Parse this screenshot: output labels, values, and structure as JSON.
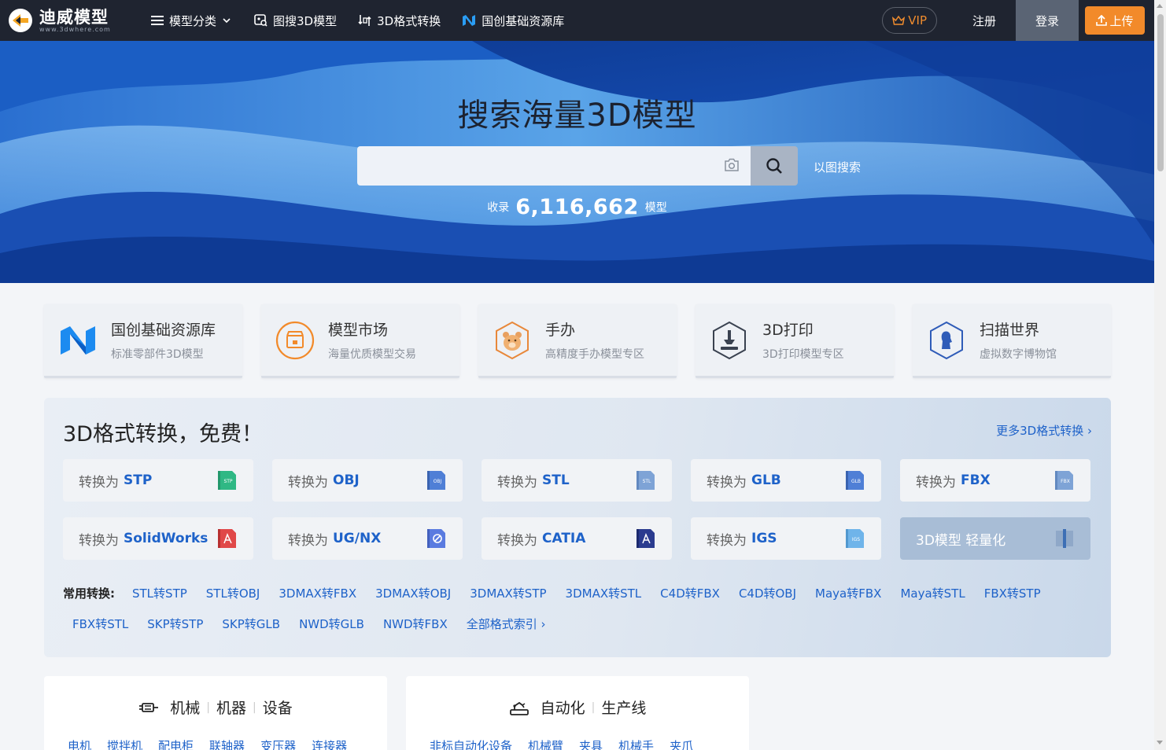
{
  "nav": {
    "logo_cn": "迪威模型",
    "logo_en": "www.3dwhere.com",
    "items": [
      {
        "label": "模型分类",
        "icon": "menu-icon"
      },
      {
        "label": "图搜3D模型",
        "icon": "image-search-icon"
      },
      {
        "label": "3D格式转换",
        "icon": "convert-icon"
      },
      {
        "label": "国创基础资源库",
        "icon": "n-logo-icon"
      }
    ],
    "vip": "VIP",
    "register": "注册",
    "login": "登录",
    "upload": "上传"
  },
  "hero": {
    "title": "搜索海量3D模型",
    "search_placeholder": "",
    "image_search": "以图搜索",
    "stats_prefix": "收录",
    "stats_count": "6,116,662",
    "stats_suffix": "模型"
  },
  "cards": [
    {
      "title": "国创基础资源库",
      "sub": "标准零部件3D模型",
      "icon": "n-logo-icon"
    },
    {
      "title": "模型市场",
      "sub": "海量优质模型交易",
      "icon": "shop-icon"
    },
    {
      "title": "手办",
      "sub": "高精度手办模型专区",
      "icon": "bear-icon"
    },
    {
      "title": "3D打印",
      "sub": "3D打印模型专区",
      "icon": "printer-icon"
    },
    {
      "title": "扫描世界",
      "sub": "虚拟数字博物馆",
      "icon": "statue-icon"
    }
  ],
  "converter": {
    "title": "3D格式转换，免费！",
    "more": "更多3D格式转换 ›",
    "prefix": "转换为",
    "row1": [
      {
        "fmt": "STP",
        "tag": "STP",
        "color": "#2fb884"
      },
      {
        "fmt": "OBJ",
        "tag": "OBJ",
        "color": "#4f7fd6"
      },
      {
        "fmt": "STL",
        "tag": "STL",
        "color": "#7ea3d6"
      },
      {
        "fmt": "GLB",
        "tag": "GLB",
        "color": "#4f7fd6"
      },
      {
        "fmt": "FBX",
        "tag": "FBX",
        "color": "#7ea3d6"
      }
    ],
    "row2": [
      {
        "fmt": "SolidWorks",
        "tag": "SW",
        "color": "#e04848"
      },
      {
        "fmt": "UG/NX",
        "tag": "NX",
        "color": "#5a7be0"
      },
      {
        "fmt": "CATIA",
        "tag": "CA",
        "color": "#2a3b8f"
      },
      {
        "fmt": "IGS",
        "tag": "IGS",
        "color": "#6fb4ea"
      }
    ],
    "lightweight": "3D模型 轻量化",
    "common_label": "常用转换:",
    "common_row1": [
      "STL转STP",
      "STL转OBJ",
      "3DMAX转FBX",
      "3DMAX转OBJ",
      "3DMAX转STP",
      "3DMAX转STL",
      "C4D转FBX",
      "C4D转OBJ",
      "Maya转FBX",
      "Maya转STL",
      "FBX转STP"
    ],
    "common_row2": [
      "FBX转STL",
      "SKP转STP",
      "SKP转GLB",
      "NWD转GLB",
      "NWD转FBX",
      "全部格式索引 ›"
    ]
  },
  "boxes": [
    {
      "head": [
        "机械",
        "机器",
        "设备"
      ],
      "icon": "machine-icon",
      "links": [
        "电机",
        "搅拌机",
        "配电柜",
        "联轴器",
        "变压器",
        "连接器"
      ]
    },
    {
      "head": [
        "自动化",
        "生产线"
      ],
      "icon": "robot-icon",
      "links": [
        "非标自动化设备",
        "机械臂",
        "夹具",
        "机械手",
        "夹爪"
      ]
    }
  ],
  "colors": {
    "nav_bg": "#1f2430",
    "accent": "#f28a2a",
    "link": "#1e62c9"
  }
}
